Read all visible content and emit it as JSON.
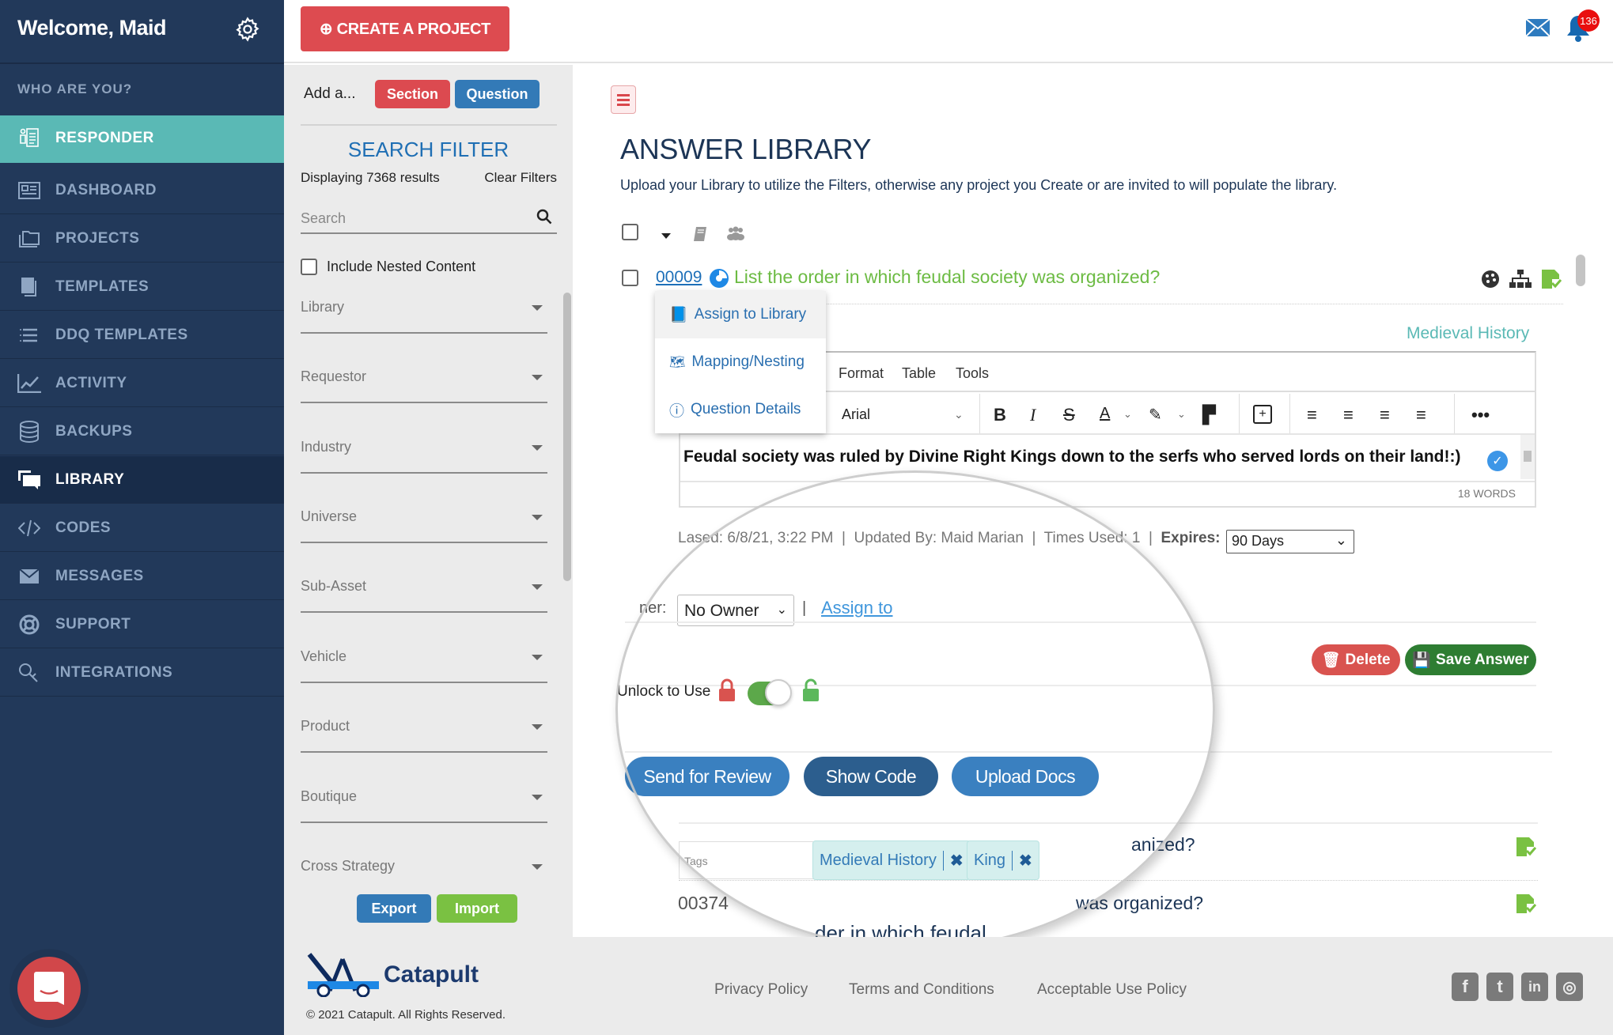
{
  "sidebar": {
    "welcome": "Welcome, Maid",
    "section_label": "WHO ARE YOU?",
    "items": [
      {
        "label": "RESPONDER",
        "icon": "responder-icon"
      },
      {
        "label": "DASHBOARD",
        "icon": "dashboard-icon"
      },
      {
        "label": "PROJECTS",
        "icon": "projects-icon"
      },
      {
        "label": "TEMPLATES",
        "icon": "templates-icon"
      },
      {
        "label": "DDQ TEMPLATES",
        "icon": "list-icon"
      },
      {
        "label": "ACTIVITY",
        "icon": "chart-icon"
      },
      {
        "label": "BACKUPS",
        "icon": "database-icon"
      },
      {
        "label": "LIBRARY",
        "icon": "comments-icon"
      },
      {
        "label": "CODES",
        "icon": "code-icon"
      },
      {
        "label": "MESSAGES",
        "icon": "envelope-icon"
      },
      {
        "label": "SUPPORT",
        "icon": "lifebuoy-icon"
      },
      {
        "label": "INTEGRATIONS",
        "icon": "integrations-icon"
      }
    ]
  },
  "topbar": {
    "create_label": "⊕ CREATE A PROJECT",
    "notification_count": "136"
  },
  "filter": {
    "add_label": "Add a...",
    "section_btn": "Section",
    "question_btn": "Question",
    "title": "SEARCH FILTER",
    "displaying": "Displaying 7368 results",
    "clear": "Clear Filters",
    "search_placeholder": "Search",
    "nested_label": "Include Nested Content",
    "selects": [
      "Library",
      "Requestor",
      "Industry",
      "Universe",
      "Sub-Asset",
      "Vehicle",
      "Product",
      "Boutique",
      "Cross Strategy"
    ],
    "export": "Export",
    "import": "Import"
  },
  "main": {
    "title": "ANSWER LIBRARY",
    "subtitle": "Upload your Library to utilize the Filters, otherwise any project you Create or are invited to will populate the library.",
    "row1": {
      "id": "00009",
      "question": "List the order in which feudal society was organized?",
      "tag_label": "Medieval History"
    },
    "context_menu": [
      "Assign to Library",
      "Mapping/Nesting",
      "Question Details"
    ],
    "editor": {
      "menus": [
        "Format",
        "Table",
        "Tools"
      ],
      "font": "Arial",
      "content": "Feudal society was ruled by Divine Right Kings down to the serfs who served lords on their land!:)",
      "word_count": "18 WORDS"
    },
    "meta": {
      "last": "Lased: 6/8/21, 3:22 PM",
      "updated_by": "Updated By: Maid Marian",
      "times_used": "Times Used: 1",
      "expires_label": "Expires:",
      "expires_value": "90 Days"
    },
    "owner_label": "ner:",
    "owner_value": "No Owner",
    "assign_to": "Assign to",
    "delete": "Delete",
    "save": "Save Answer",
    "unlock_label": "Unlock to Use",
    "unlocked": true,
    "send_review": "Send for Review",
    "show_code": "Show Code",
    "upload_docs": "Upload Docs",
    "tags_placeholder": "Tags",
    "tags": [
      "Medieval History",
      "King"
    ],
    "row2_text": "anized?",
    "row3_id": "00374",
    "row3_text": "was organized?",
    "row4_text": "der in which feudal"
  },
  "footer": {
    "brand": "Catapult",
    "copyright": "© 2021 Catapult. All Rights Reserved.",
    "links": [
      "Privacy Policy",
      "Terms and Conditions",
      "Acceptable Use Policy"
    ],
    "social": [
      "facebook-icon",
      "twitter-icon",
      "linkedin-icon",
      "instagram-icon"
    ]
  },
  "colors": {
    "sidebar": "#22395a",
    "responder": "#5ab9b5",
    "danger": "#dd4b50",
    "primary": "#337ab7",
    "success": "#7ac142",
    "question_green": "#6cbb43"
  }
}
